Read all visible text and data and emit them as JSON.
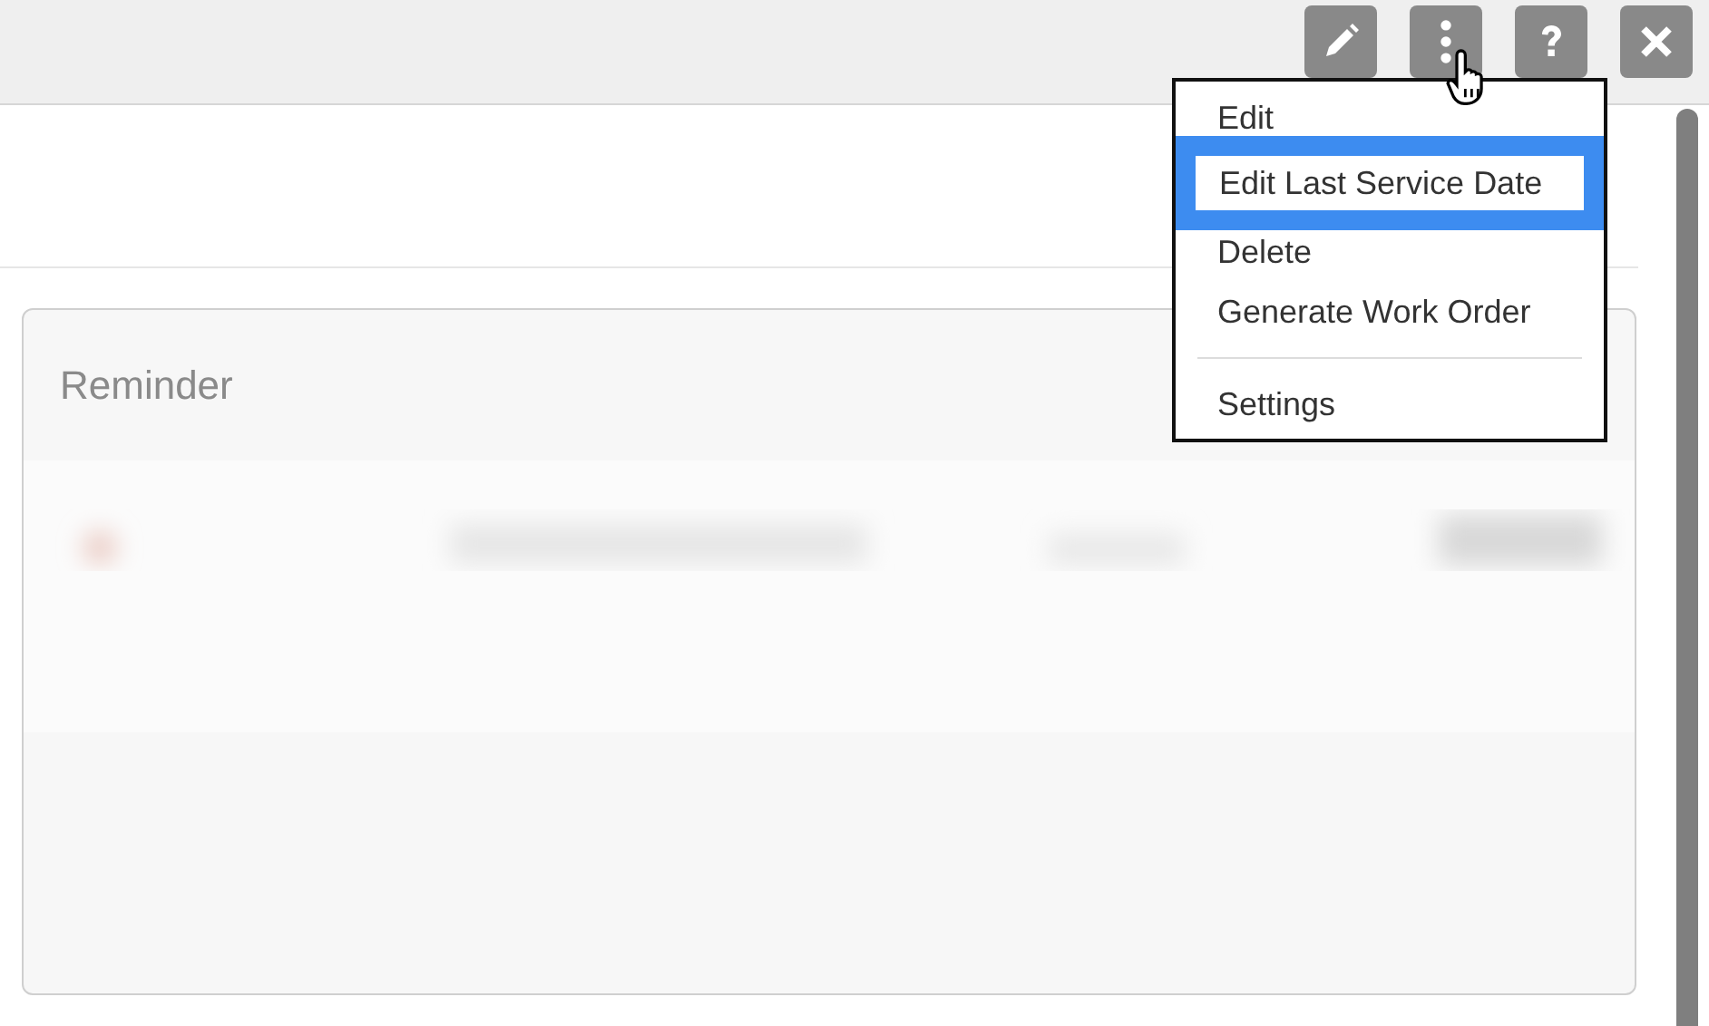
{
  "toolbar": {
    "buttons": [
      {
        "kind": "edit"
      },
      {
        "kind": "more"
      },
      {
        "kind": "help"
      },
      {
        "kind": "close"
      }
    ]
  },
  "card": {
    "title": "Reminder"
  },
  "menu": {
    "items": [
      {
        "label": "Edit",
        "selected": false
      },
      {
        "label": "Edit Last Service Date",
        "selected": true
      },
      {
        "label": "Delete",
        "selected": false
      },
      {
        "label": "Generate Work Order",
        "selected": false
      },
      {
        "kind": "divider"
      },
      {
        "label": "Settings",
        "selected": false
      }
    ]
  }
}
